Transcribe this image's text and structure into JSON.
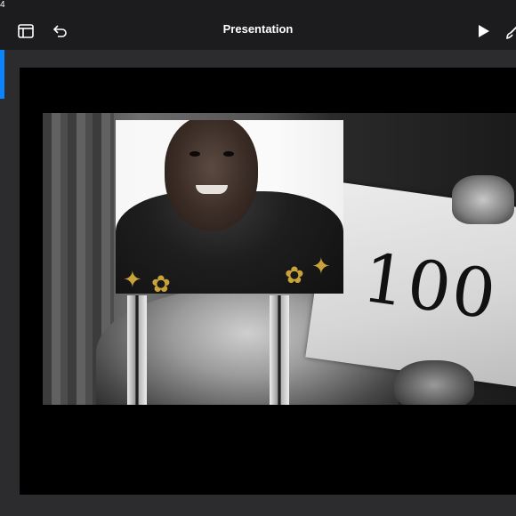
{
  "status": {
    "text": "4"
  },
  "toolbar": {
    "title": "Presentation",
    "buttons": [
      "slides-panel",
      "undo",
      "play",
      "format-brush"
    ]
  },
  "slide": {
    "sign_text": "100"
  },
  "colors": {
    "accent": "#0a84ff",
    "toolbar_bg": "#1c1c1e",
    "canvas_bg": "#2c2c2e",
    "slide_bg": "#000000"
  }
}
